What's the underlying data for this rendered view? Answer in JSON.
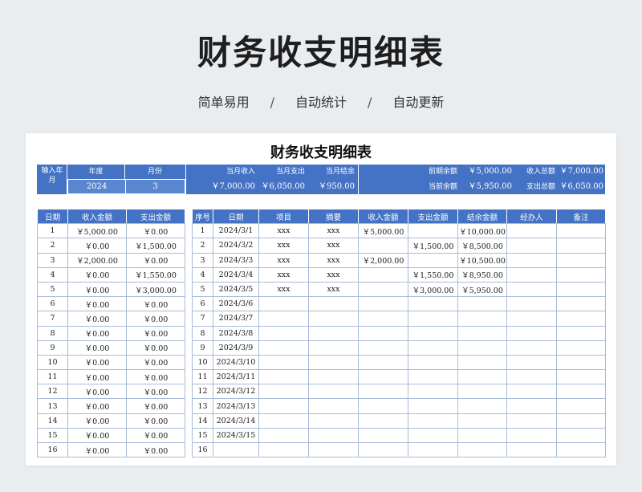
{
  "page": {
    "title": "财务收支明细表",
    "subtitle": {
      "items": [
        "简单易用",
        "自动统计",
        "自动更新"
      ],
      "separator": "/"
    }
  },
  "sheet": {
    "title": "财务收支明细表",
    "summary": {
      "input_label": "输入年月",
      "year_label": "年度",
      "year_value": "2024",
      "month_label": "月份",
      "month_value": "3",
      "month_income_label": "当月收入",
      "month_income_value": "￥7,000.00",
      "month_expense_label": "当月支出",
      "month_expense_value": "￥6,050.00",
      "month_balance_label": "当月结余",
      "month_balance_value": "￥950.00",
      "prev_balance_label": "前期余额",
      "prev_balance_value": "￥5,000.00",
      "current_balance_label": "当前余额",
      "current_balance_value": "￥5,950.00",
      "total_income_label": "收入总额",
      "total_income_value": "￥7,000.00",
      "total_expense_label": "支出总额",
      "total_expense_value": "￥6,050.00"
    },
    "left_table": {
      "headers": [
        "日期",
        "收入金额",
        "支出金额"
      ],
      "rows": [
        [
          "1",
          "￥5,000.00",
          "￥0.00"
        ],
        [
          "2",
          "￥0.00",
          "￥1,500.00"
        ],
        [
          "3",
          "￥2,000.00",
          "￥0.00"
        ],
        [
          "4",
          "￥0.00",
          "￥1,550.00"
        ],
        [
          "5",
          "￥0.00",
          "￥3,000.00"
        ],
        [
          "6",
          "￥0.00",
          "￥0.00"
        ],
        [
          "7",
          "￥0.00",
          "￥0.00"
        ],
        [
          "8",
          "￥0.00",
          "￥0.00"
        ],
        [
          "9",
          "￥0.00",
          "￥0.00"
        ],
        [
          "10",
          "￥0.00",
          "￥0.00"
        ],
        [
          "11",
          "￥0.00",
          "￥0.00"
        ],
        [
          "12",
          "￥0.00",
          "￥0.00"
        ],
        [
          "13",
          "￥0.00",
          "￥0.00"
        ],
        [
          "14",
          "￥0.00",
          "￥0.00"
        ],
        [
          "15",
          "￥0.00",
          "￥0.00"
        ],
        [
          "16",
          "￥0.00",
          "￥0.00"
        ]
      ]
    },
    "right_table": {
      "headers": [
        "序号",
        "日期",
        "项目",
        "摘要",
        "收入金额",
        "支出金额",
        "结余金额",
        "经办人",
        "备注"
      ],
      "rows": [
        [
          "1",
          "2024/3/1",
          "xxx",
          "xxx",
          "￥5,000.00",
          "",
          "￥10,000.00",
          "",
          ""
        ],
        [
          "2",
          "2024/3/2",
          "xxx",
          "xxx",
          "",
          "￥1,500.00",
          "￥8,500.00",
          "",
          ""
        ],
        [
          "3",
          "2024/3/3",
          "xxx",
          "xxx",
          "￥2,000.00",
          "",
          "￥10,500.00",
          "",
          ""
        ],
        [
          "4",
          "2024/3/4",
          "xxx",
          "xxx",
          "",
          "￥1,550.00",
          "￥8,950.00",
          "",
          ""
        ],
        [
          "5",
          "2024/3/5",
          "xxx",
          "xxx",
          "",
          "￥3,000.00",
          "￥5,950.00",
          "",
          ""
        ],
        [
          "6",
          "2024/3/6",
          "",
          "",
          "",
          "",
          "",
          "",
          ""
        ],
        [
          "7",
          "2024/3/7",
          "",
          "",
          "",
          "",
          "",
          "",
          ""
        ],
        [
          "8",
          "2024/3/8",
          "",
          "",
          "",
          "",
          "",
          "",
          ""
        ],
        [
          "9",
          "2024/3/9",
          "",
          "",
          "",
          "",
          "",
          "",
          ""
        ],
        [
          "10",
          "2024/3/10",
          "",
          "",
          "",
          "",
          "",
          "",
          ""
        ],
        [
          "11",
          "2024/3/11",
          "",
          "",
          "",
          "",
          "",
          "",
          ""
        ],
        [
          "12",
          "2024/3/12",
          "",
          "",
          "",
          "",
          "",
          "",
          ""
        ],
        [
          "13",
          "2024/3/13",
          "",
          "",
          "",
          "",
          "",
          "",
          ""
        ],
        [
          "14",
          "2024/3/14",
          "",
          "",
          "",
          "",
          "",
          "",
          ""
        ],
        [
          "15",
          "2024/3/15",
          "",
          "",
          "",
          "",
          "",
          "",
          ""
        ],
        [
          "16",
          "",
          "",
          "",
          "",
          "",
          "",
          "",
          ""
        ]
      ]
    }
  },
  "colors": {
    "header_blue": "#4472c4",
    "grid": "#a9bbd8",
    "background": "#eaedf0"
  }
}
